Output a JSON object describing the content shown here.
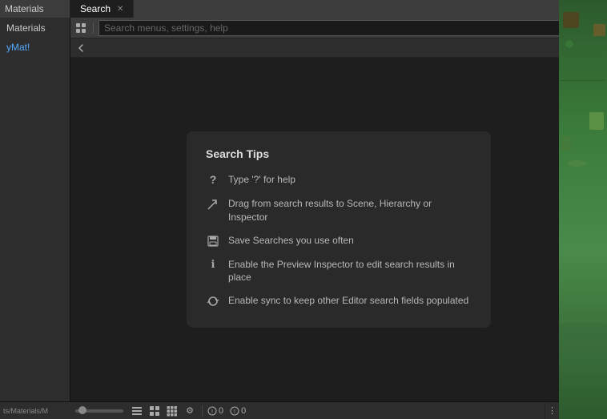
{
  "window": {
    "title": "Search"
  },
  "tabs": [
    {
      "label": "Search",
      "active": true
    }
  ],
  "top_right_buttons": [
    "?",
    "⋮",
    "✕"
  ],
  "sidebar": {
    "top_label": "Materials",
    "sub_item": "yMat!",
    "bottom_path": "ts/Materials/M"
  },
  "search_bar": {
    "placeholder": "Search menus, settings, help",
    "value": ""
  },
  "second_toolbar": {
    "back_icon": "←",
    "more_icon": "⋮"
  },
  "search_tips": {
    "title": "Search Tips",
    "tips": [
      {
        "icon": "?",
        "icon_type": "question",
        "text": "Type '?' for help"
      },
      {
        "icon": "↗",
        "icon_type": "drag",
        "text": "Drag from search results to Scene, Hierarchy or Inspector"
      },
      {
        "icon": "⊞",
        "icon_type": "save",
        "text": "Save Searches you use often"
      },
      {
        "icon": "ℹ",
        "icon_type": "info",
        "text": "Enable the Preview Inspector to edit search results in place"
      },
      {
        "icon": "↺",
        "icon_type": "sync",
        "text": "Enable sync to keep other Editor search fields populated"
      }
    ]
  },
  "status_bar": {
    "list_icon": "☰",
    "grid2_icon": "⊞",
    "grid3_icon": "⊟",
    "gear_icon": "⚙",
    "count1": "0",
    "count2": "0",
    "more_icon": "⋮"
  },
  "colors": {
    "accent_blue": "#5af",
    "background_dark": "#1e1e1e",
    "card_bg": "#2a2a2a",
    "tab_active": "#1e1e1e",
    "tab_inactive": "#3c3c3c"
  }
}
